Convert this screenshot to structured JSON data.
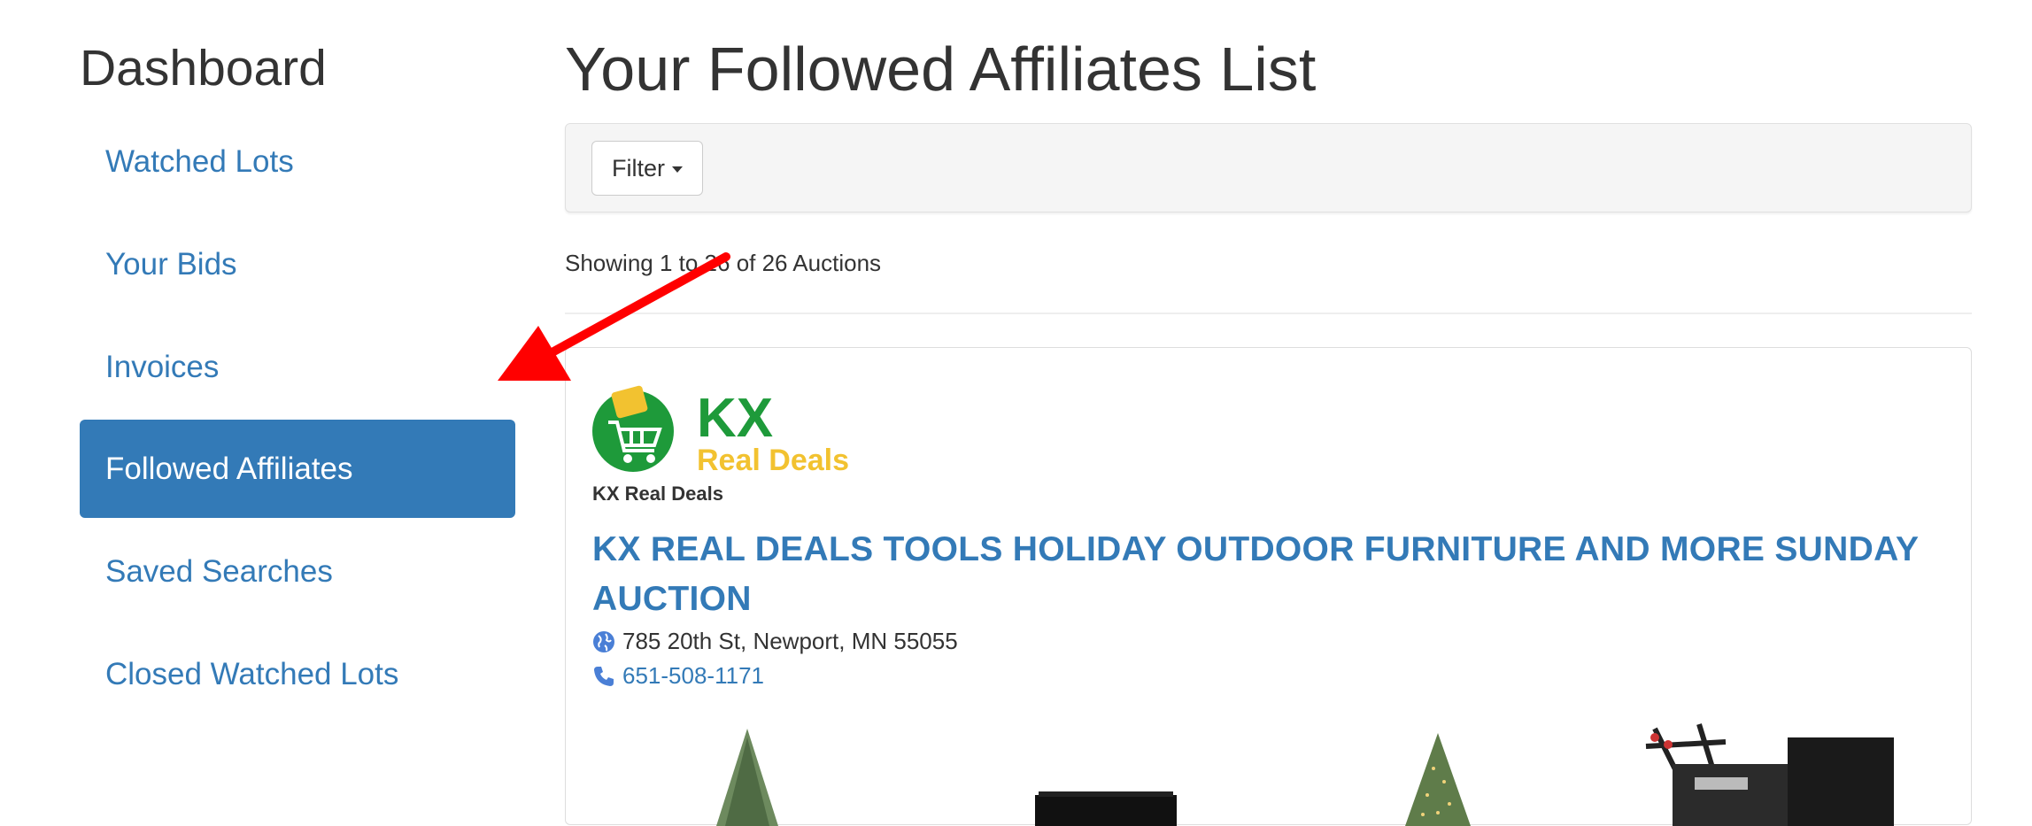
{
  "sidebar": {
    "title": "Dashboard",
    "items": [
      {
        "label": "Watched Lots"
      },
      {
        "label": "Your Bids"
      },
      {
        "label": "Invoices"
      },
      {
        "label": "Followed Affiliates",
        "active": true
      },
      {
        "label": "Saved Searches"
      },
      {
        "label": "Closed Watched Lots"
      }
    ]
  },
  "main": {
    "title": "Your Followed Affiliates List",
    "filter_label": "Filter",
    "showing_text": "Showing 1 to 26 of 26 Auctions",
    "card": {
      "logo_text_top": "KX",
      "logo_text_bottom": "Real Deals",
      "affiliate_name": "KX Real Deals",
      "auction_title": "KX REAL DEALS TOOLS HOLIDAY OUTDOOR FURNITURE AND MORE SUNDAY AUCTION",
      "address": "785 20th St, Newport, MN 55055",
      "phone": "651-508-1171",
      "address_icon": "globe-icon",
      "phone_icon": "phone-icon"
    }
  },
  "colors": {
    "link": "#337ab7",
    "active_bg": "#337ab7",
    "logo_green": "#1e9a3a",
    "logo_yellow": "#f2c230",
    "annotation_arrow": "#ff0000"
  }
}
